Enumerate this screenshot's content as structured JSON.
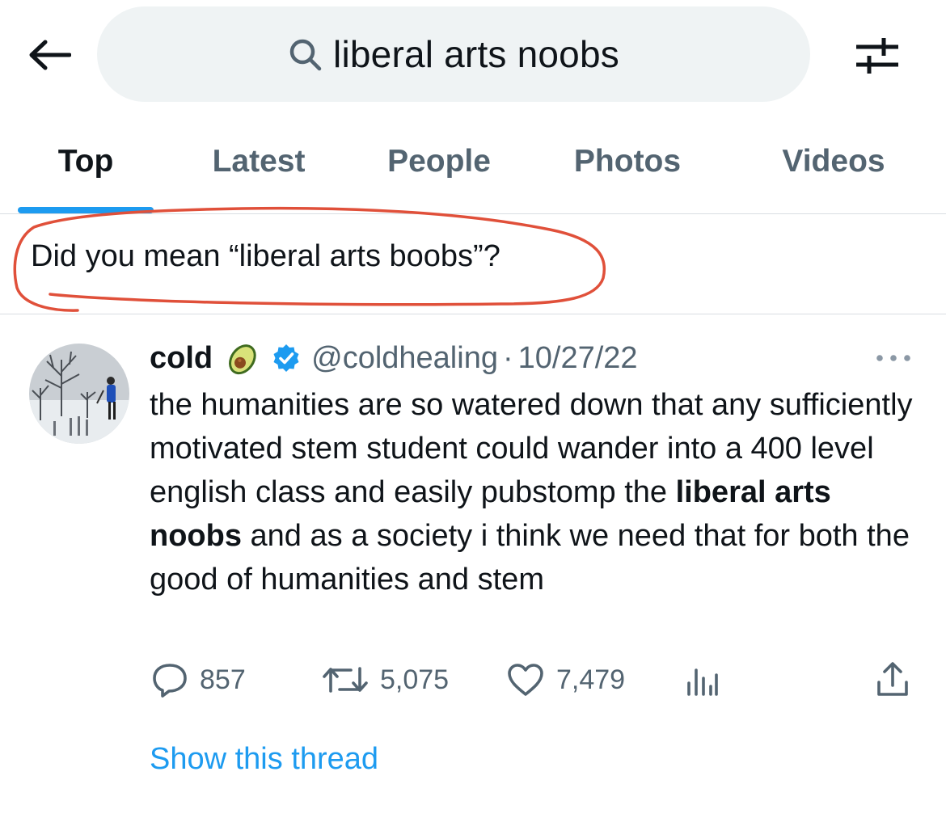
{
  "search": {
    "query": "liberal arts noobs"
  },
  "tabs": [
    {
      "label": "Top",
      "active": true
    },
    {
      "label": "Latest",
      "active": false
    },
    {
      "label": "People",
      "active": false
    },
    {
      "label": "Photos",
      "active": false
    },
    {
      "label": "Videos",
      "active": false
    }
  ],
  "suggestion": {
    "text": "Did you mean “liberal arts boobs”?",
    "annotation_color": "#e0503a"
  },
  "tweet": {
    "author": "cold",
    "author_emoji": "avocado-icon",
    "verified": true,
    "handle": "@coldhealing",
    "separator": "·",
    "date": "10/27/22",
    "text_before": "the humanities are so watered down that any sufficiently motivated stem student could wander into a 400 level english class and easily pubstomp the ",
    "text_bold": "liberal arts noobs",
    "text_after": " and as a society i think we need that for both the good of humanities and stem",
    "replies": "857",
    "retweets": "5,075",
    "likes": "7,479",
    "show_thread": "Show this thread"
  },
  "colors": {
    "accent": "#1d9bf0",
    "muted": "#536471",
    "text": "#0f1419",
    "pill": "#eff3f4"
  }
}
